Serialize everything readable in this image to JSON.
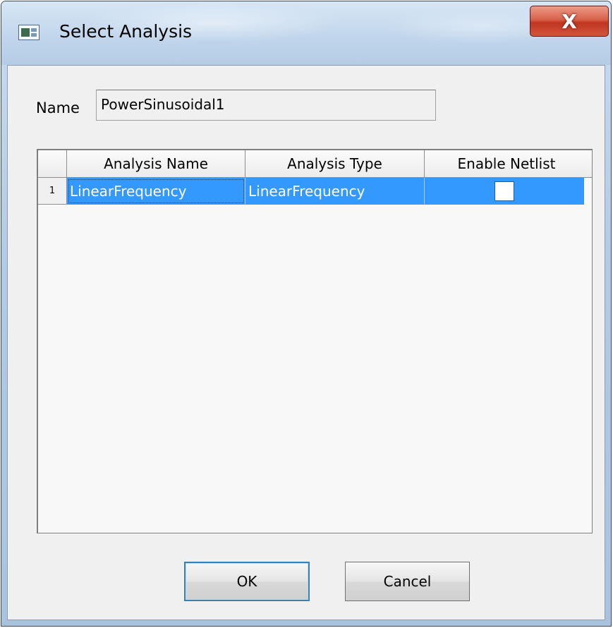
{
  "window": {
    "title": "Select Analysis",
    "close_label": "X"
  },
  "form": {
    "name_label": "Name",
    "name_value": "PowerSinusoidal1"
  },
  "table": {
    "columns": [
      "Analysis Name",
      "Analysis Type",
      "Enable Netlist"
    ],
    "rows": [
      {
        "row_number": "1",
        "analysis_name": "LinearFrequency",
        "analysis_type": "LinearFrequency",
        "enable_netlist": false
      }
    ]
  },
  "buttons": {
    "ok_label": "OK",
    "cancel_label": "Cancel"
  },
  "colors": {
    "selection": "#3399ff",
    "close_button": "#c9452f"
  },
  "icons": {
    "app": "app-window-icon",
    "close": "close-icon"
  }
}
